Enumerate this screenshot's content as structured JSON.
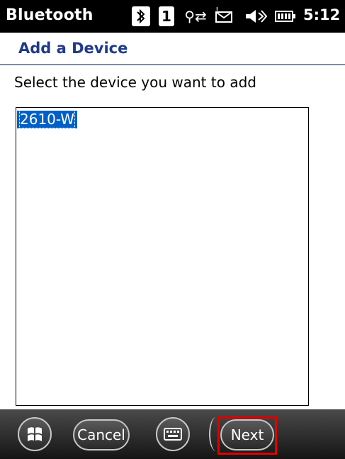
{
  "title_bar": {
    "app_name": "Bluetooth",
    "icons": [
      "bluetooth-icon",
      "channel-icon",
      "network-icon",
      "message-icon",
      "volume-icon",
      "battery-icon"
    ],
    "channel_number": "1",
    "time": "5:12"
  },
  "header": {
    "title": "Add a Device"
  },
  "content": {
    "instruction": "Select the device you want to add",
    "devices": [
      "2610-W"
    ],
    "selected_device": "2610-W"
  },
  "menu_bar": {
    "cancel_label": "Cancel",
    "next_label": "Next",
    "highlight_color": "#e10000"
  }
}
